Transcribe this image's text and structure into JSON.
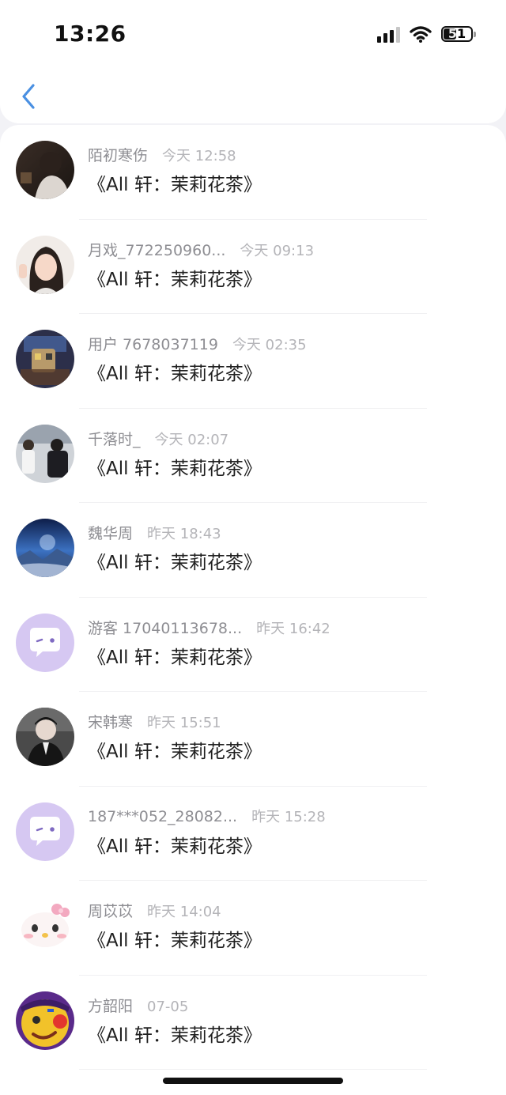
{
  "status_bar": {
    "time": "13:26",
    "battery": "51",
    "battery_level": 0.51
  },
  "nav": {
    "back_icon": "chevron-left-icon",
    "accent": "#4a90e2"
  },
  "conversations": [
    {
      "username": "陌初寒伤",
      "time": "今天 12:58",
      "message": "《All 轩：茉莉花茶》",
      "avatar": "photo-dark-portrait"
    },
    {
      "username": "月戏_772250960...",
      "time": "今天 09:13",
      "message": "《All 轩：茉莉花茶》",
      "avatar": "photo-girl-selfie"
    },
    {
      "username": "用户 7678037119",
      "time": "今天 02:35",
      "message": "《All 轩：茉莉花茶》",
      "avatar": "photo-blurred-pixel"
    },
    {
      "username": "千落时_",
      "time": "今天 02:07",
      "message": "《All 轩：茉莉花茶》",
      "avatar": "photo-two-people"
    },
    {
      "username": "魏华周",
      "time": "昨天 18:43",
      "message": "《All 轩：茉莉花茶》",
      "avatar": "photo-night-landscape"
    },
    {
      "username": "游客 17040113678...",
      "time": "昨天 16:42",
      "message": "《All 轩：茉莉花茶》",
      "avatar": "default-chat-avatar-icon"
    },
    {
      "username": "宋韩寒",
      "time": "昨天 15:51",
      "message": "《All 轩：茉莉花茶》",
      "avatar": "photo-man-dark-jacket"
    },
    {
      "username": "187***052_28082...",
      "time": "昨天 15:28",
      "message": "《All 轩：茉莉花茶》",
      "avatar": "default-chat-avatar-icon"
    },
    {
      "username": "周苡苡",
      "time": "昨天 14:04",
      "message": "《All 轩：茉莉花茶》",
      "avatar": "cartoon-kitty-icon"
    },
    {
      "username": "方韶阳",
      "time": "07-05",
      "message": "《All 轩：茉莉花茶》",
      "avatar": "cartoon-yellow-face"
    }
  ]
}
